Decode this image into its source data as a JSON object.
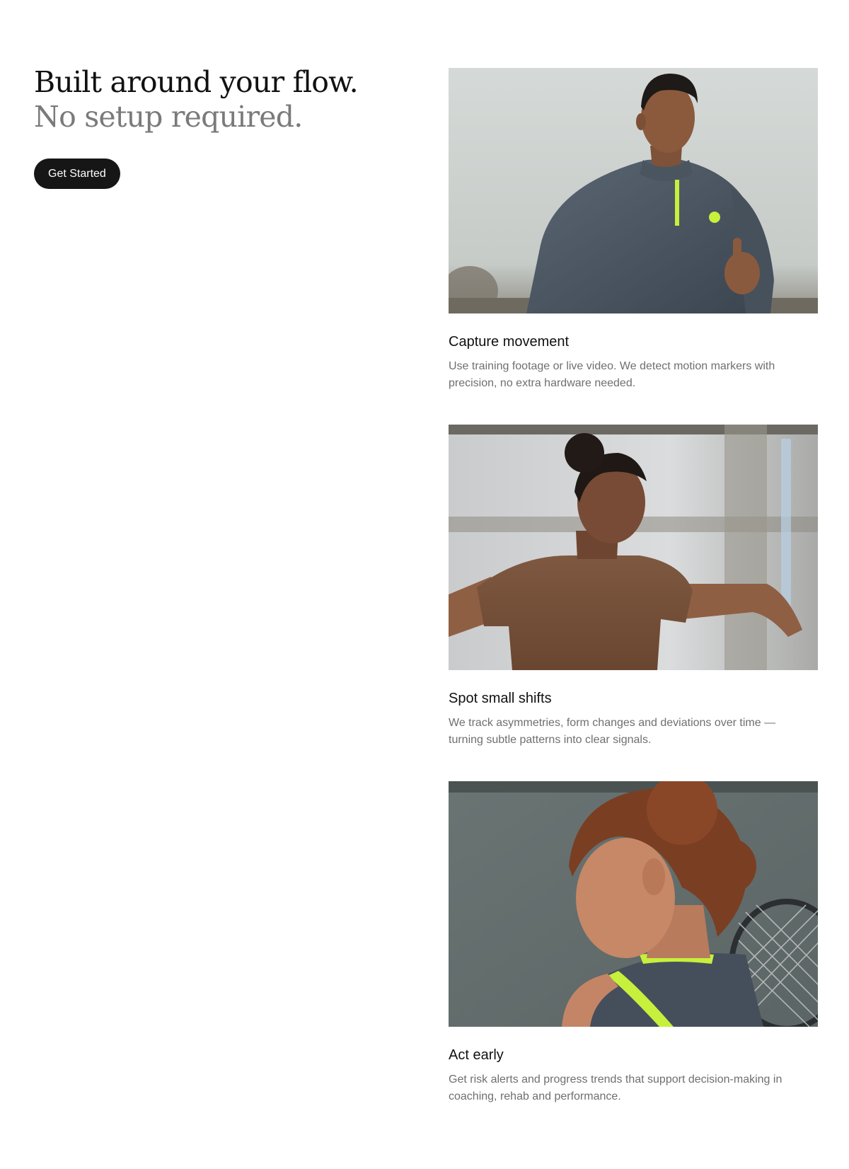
{
  "hero": {
    "headline_primary": "Built around your flow.",
    "headline_secondary": "No setup required.",
    "cta_label": "Get Started"
  },
  "features": [
    {
      "title": "Capture movement",
      "description": "Use training footage or live video. We detect motion markers with precision, no extra hardware needed.",
      "image": "runner-photo"
    },
    {
      "title": "Spot small shifts",
      "description": "We track asymmetries, form changes and deviations over time — turning subtle patterns into clear signals.",
      "image": "gymnast-photo"
    },
    {
      "title": "Act early",
      "description": "Get risk alerts and progress trends that support decision-making in coaching, rehab and performance.",
      "image": "tennis-player-photo"
    }
  ],
  "colors": {
    "text_primary": "#111111",
    "text_secondary": "#7a7a7a",
    "body_text": "#6f6f6f",
    "button_background": "#161616",
    "button_text": "#ffffff",
    "accent_lime": "#c6f03c"
  }
}
